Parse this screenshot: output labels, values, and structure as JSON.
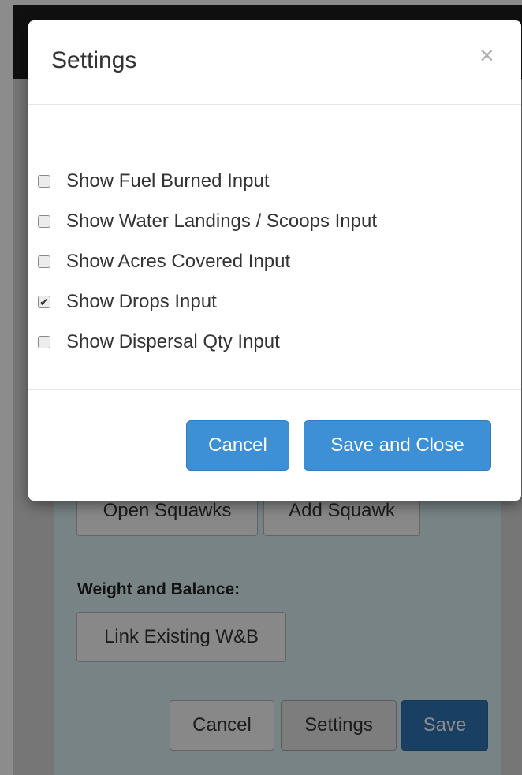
{
  "background": {
    "buttons": {
      "open_squawks": "Open Squawks",
      "add_squawk": "Add Squawk",
      "link_wb": "Link Existing W&B",
      "cancel": "Cancel",
      "settings": "Settings",
      "save": "Save"
    },
    "weight_balance_label": "Weight and Balance:"
  },
  "modal": {
    "title": "Settings",
    "close_glyph": "×",
    "options": [
      {
        "label": "Show Fuel Burned Input",
        "checked": false
      },
      {
        "label": "Show Water Landings / Scoops Input",
        "checked": false
      },
      {
        "label": "Show Acres Covered Input",
        "checked": false
      },
      {
        "label": "Show Drops Input",
        "checked": true
      },
      {
        "label": "Show Dispersal Qty Input",
        "checked": false
      }
    ],
    "footer": {
      "cancel_label": "Cancel",
      "save_close_label": "Save and Close"
    }
  },
  "colors": {
    "primary": "#3d8fd6",
    "navbar": "#1e1e1e",
    "panel": "#d9eef3"
  }
}
